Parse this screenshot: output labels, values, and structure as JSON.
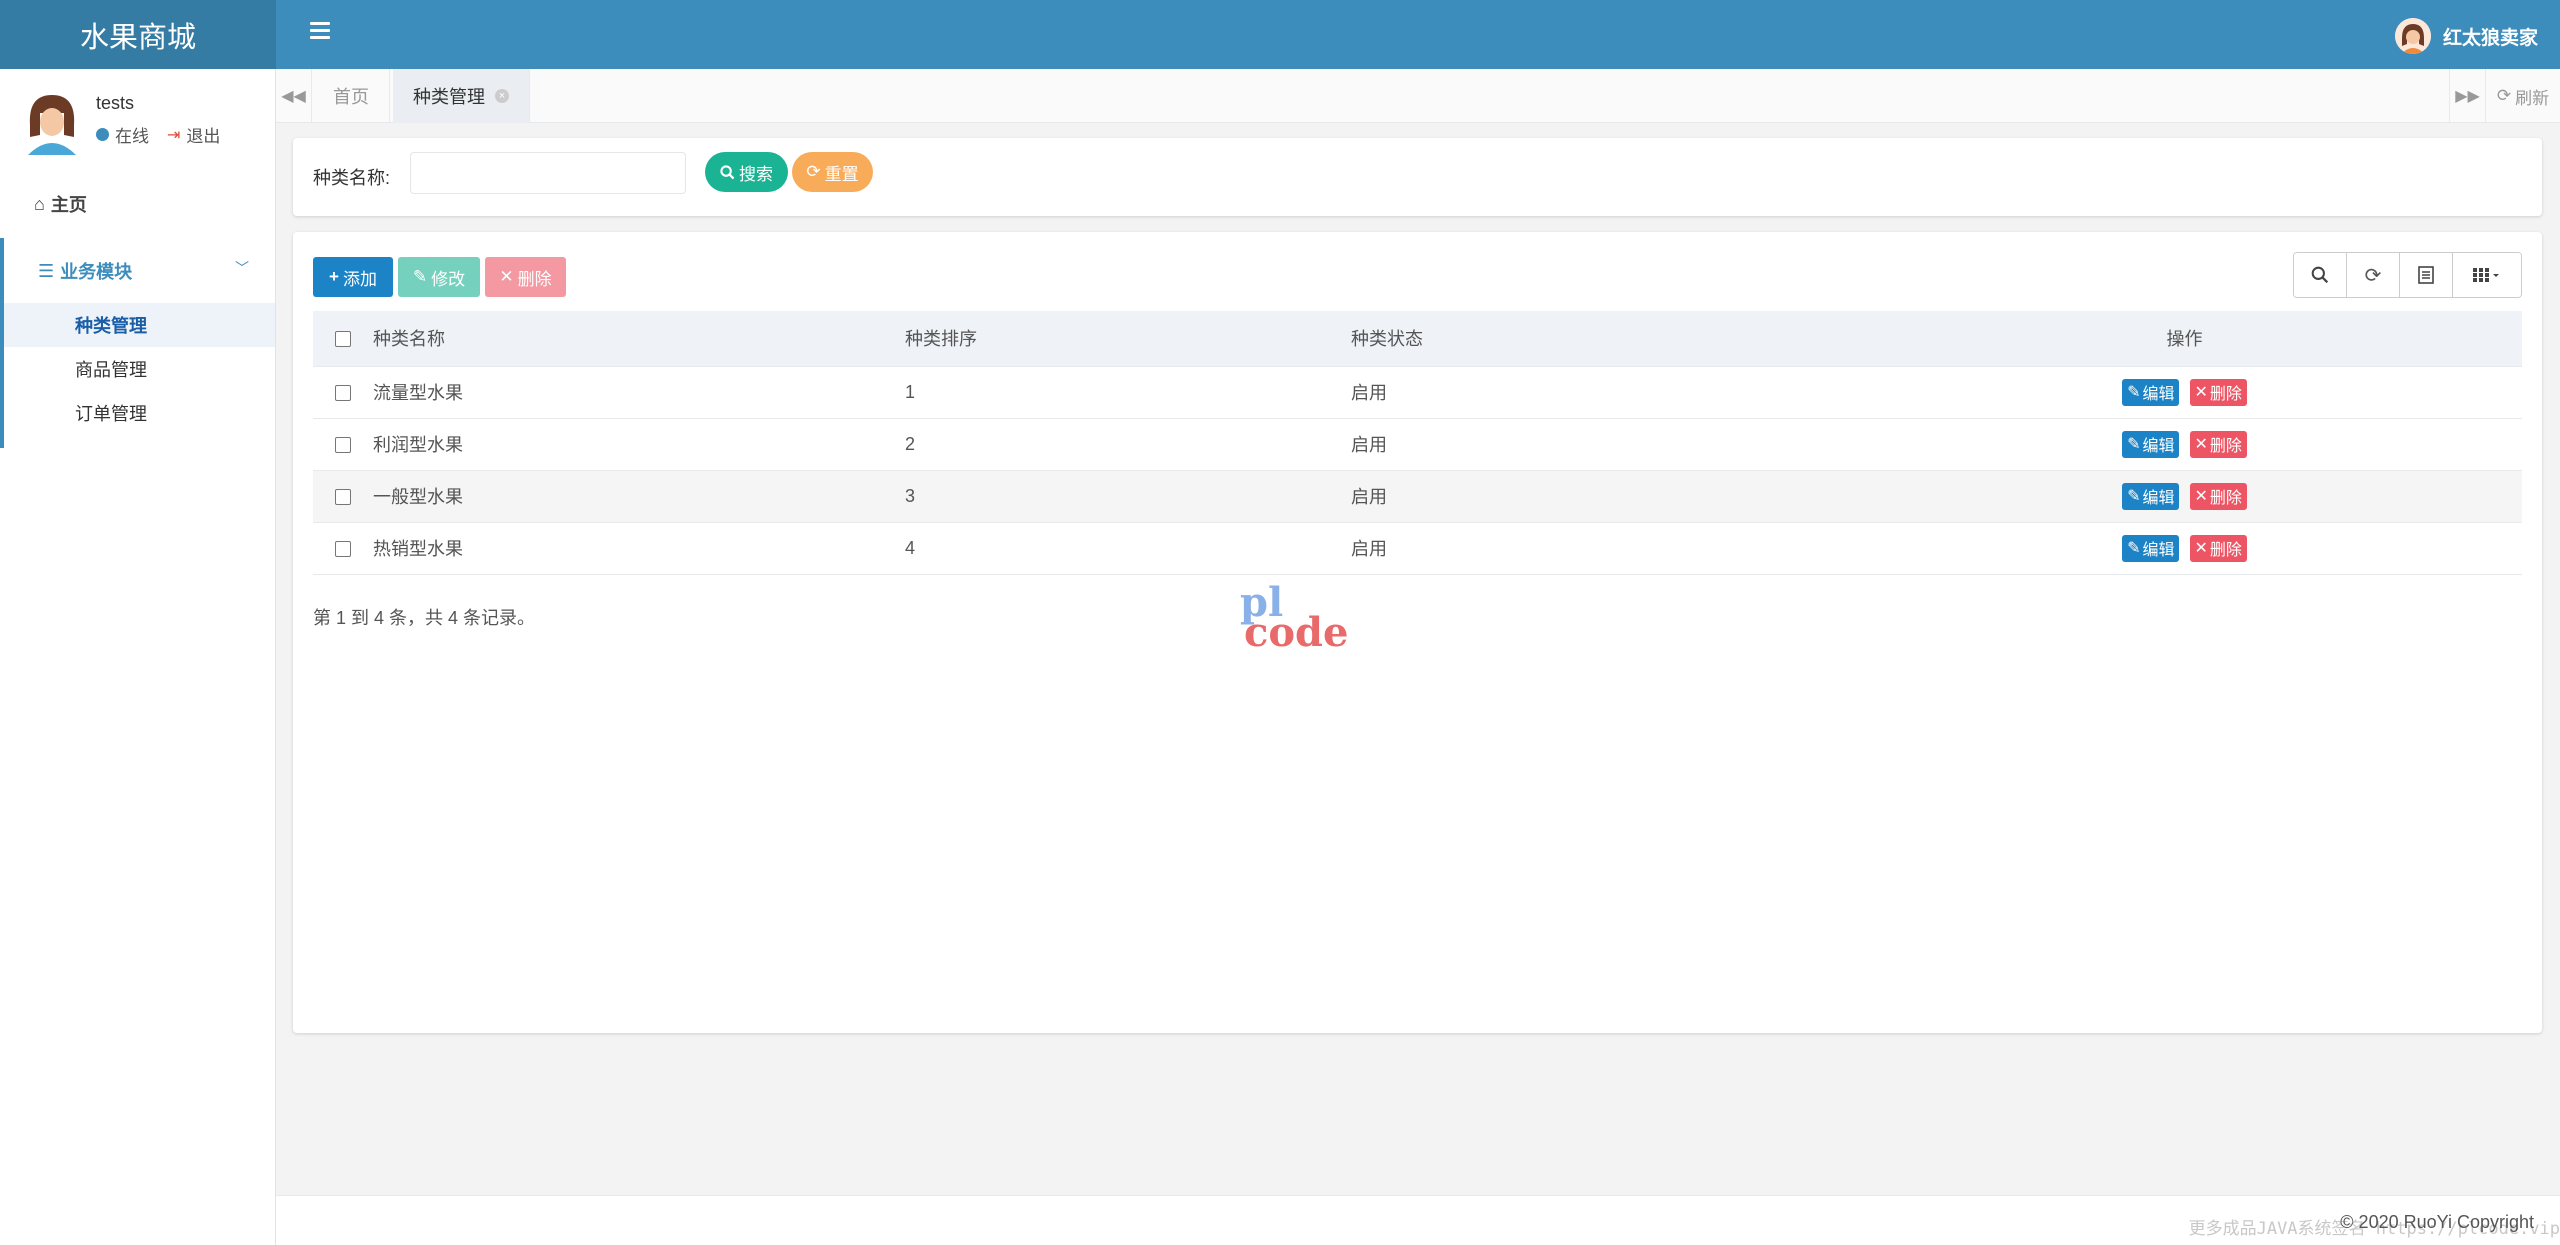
{
  "app": {
    "title": "水果商城"
  },
  "header": {
    "menu_icon": "bars-icon",
    "user_name": "红太狼卖家"
  },
  "sidebar": {
    "user": {
      "name": "tests",
      "status": "在线",
      "logout": "退出"
    },
    "home": "主页",
    "group": {
      "title": "业务模块"
    },
    "items": [
      {
        "label": "种类管理",
        "active": true
      },
      {
        "label": "商品管理",
        "active": false
      },
      {
        "label": "订单管理",
        "active": false
      }
    ]
  },
  "tabs": {
    "items": [
      {
        "label": "首页",
        "active": false
      },
      {
        "label": "种类管理",
        "active": true
      }
    ],
    "refresh": "刷新"
  },
  "search": {
    "label": "种类名称:",
    "value": "",
    "placeholder": "",
    "search_button": "搜索",
    "reset_button": "重置"
  },
  "toolbar": {
    "add": "添加",
    "edit": "修改",
    "delete": "删除"
  },
  "table": {
    "columns": [
      "种类名称",
      "种类排序",
      "种类状态",
      "操作"
    ],
    "rows": [
      {
        "name": "流量型水果",
        "sort": "1",
        "status": "启用"
      },
      {
        "name": "利润型水果",
        "sort": "2",
        "status": "启用"
      },
      {
        "name": "一般型水果",
        "sort": "3",
        "status": "启用"
      },
      {
        "name": "热销型水果",
        "sort": "4",
        "status": "启用"
      }
    ],
    "row_actions": {
      "edit": "编辑",
      "delete": "删除"
    },
    "pagination_info": "第 1 到 4 条，共 4 条记录。"
  },
  "watermark": {
    "line1": "pl",
    "line2": "code"
  },
  "footer": {
    "ad": "更多成品JAVA系统签名 https://plcode.vip",
    "copyright": "© 2020 RuoYi Copyright"
  },
  "colors": {
    "header": "#3c8dbc",
    "logo_bg": "#357ca5",
    "primary": "#1c84c6",
    "success": "#1ab394",
    "warning": "#f8ac59",
    "danger": "#ed5565"
  }
}
